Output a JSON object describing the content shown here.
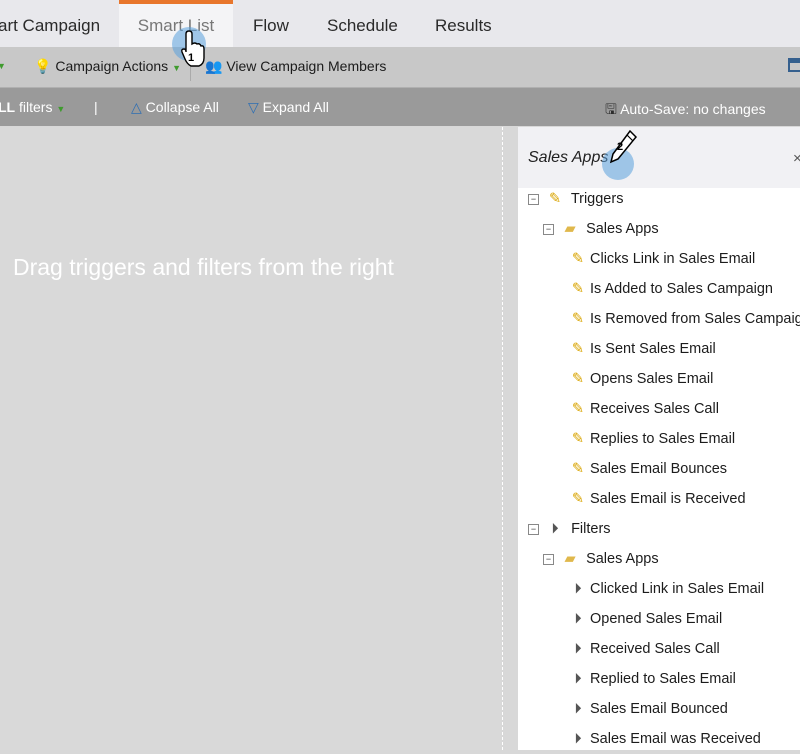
{
  "tabs": [
    {
      "label": "art Campaign",
      "active": false
    },
    {
      "label": "Smart List",
      "active": true
    },
    {
      "label": "Flow",
      "active": false
    },
    {
      "label": "Schedule",
      "active": false
    },
    {
      "label": "Results",
      "active": false
    }
  ],
  "toolbar1": {
    "campaign_actions": "Campaign Actions",
    "view_members": "View Campaign Members"
  },
  "toolbar2": {
    "filters_bold": "LL",
    "filters_label": "filters",
    "separator": "|",
    "collapse_all": "Collapse All",
    "expand_all": "Expand All",
    "autosave": "Auto-Save: no changes"
  },
  "canvas": {
    "hint": "Drag triggers and filters from the right"
  },
  "panel": {
    "title": "Sales Apps",
    "close": "×",
    "triggers_label": "Triggers",
    "triggers_folder": "Sales Apps",
    "triggers": [
      "Clicks Link in Sales Email",
      "Is Added to Sales Campaign",
      "Is Removed from Sales Campaign",
      "Is Sent Sales Email",
      "Opens Sales Email",
      "Receives Sales Call",
      "Replies to Sales Email",
      "Sales Email Bounces",
      "Sales Email is Received"
    ],
    "filters_label": "Filters",
    "filters_folder": "Sales Apps",
    "filters": [
      "Clicked Link in Sales Email",
      "Opened Sales Email",
      "Received Sales Call",
      "Replied to Sales Email",
      "Sales Email Bounced",
      "Sales Email was Received"
    ]
  },
  "annotations": {
    "step1": "1",
    "step2": "2"
  },
  "icons": {
    "accent": "#e8762c"
  }
}
